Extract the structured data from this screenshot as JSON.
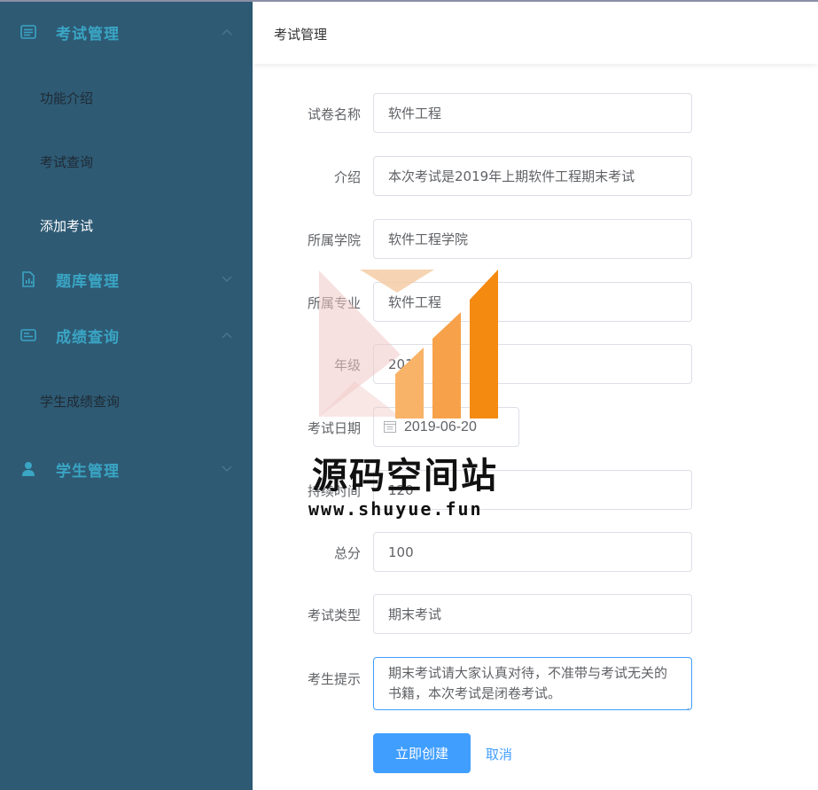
{
  "sidebar": {
    "groups": [
      {
        "title": "考试管理",
        "icon": "list-icon",
        "expanded": true,
        "items": [
          {
            "label": "功能介绍"
          },
          {
            "label": "考试查询"
          },
          {
            "label": "添加考试",
            "active": true
          }
        ]
      },
      {
        "title": "题库管理",
        "icon": "document-chart-icon",
        "expanded": false,
        "items": []
      },
      {
        "title": "成绩查询",
        "icon": "id-card-icon",
        "expanded": true,
        "items": [
          {
            "label": "学生成绩查询"
          }
        ]
      },
      {
        "title": "学生管理",
        "icon": "user-icon",
        "expanded": false,
        "items": []
      }
    ]
  },
  "header": {
    "breadcrumb": "考试管理"
  },
  "form": {
    "fields": [
      {
        "label": "试卷名称",
        "value": "软件工程"
      },
      {
        "label": "介绍",
        "value": "本次考试是2019年上期软件工程期末考试"
      },
      {
        "label": "所属学院",
        "value": "软件工程学院"
      },
      {
        "label": "所属专业",
        "value": "软件工程"
      },
      {
        "label": "年级",
        "value": "2018"
      },
      {
        "label": "考试日期",
        "value": "2019-06-20"
      },
      {
        "label": "持续时间",
        "value": "120"
      },
      {
        "label": "总分",
        "value": "100"
      },
      {
        "label": "考试类型",
        "value": "期末考试"
      },
      {
        "label": "考生提示",
        "value": "期末考试请大家认真对待，不准带与考试无关的书籍，本次考试是闭卷考试。"
      }
    ],
    "submit_label": "立即创建",
    "cancel_label": "取消"
  },
  "watermark": {
    "title": "源码空间站",
    "url": "www.shuyue.fun"
  },
  "colors": {
    "sidebar_bg": "#2e5a74",
    "group_title": "#3aa5c4",
    "primary": "#409eff"
  }
}
